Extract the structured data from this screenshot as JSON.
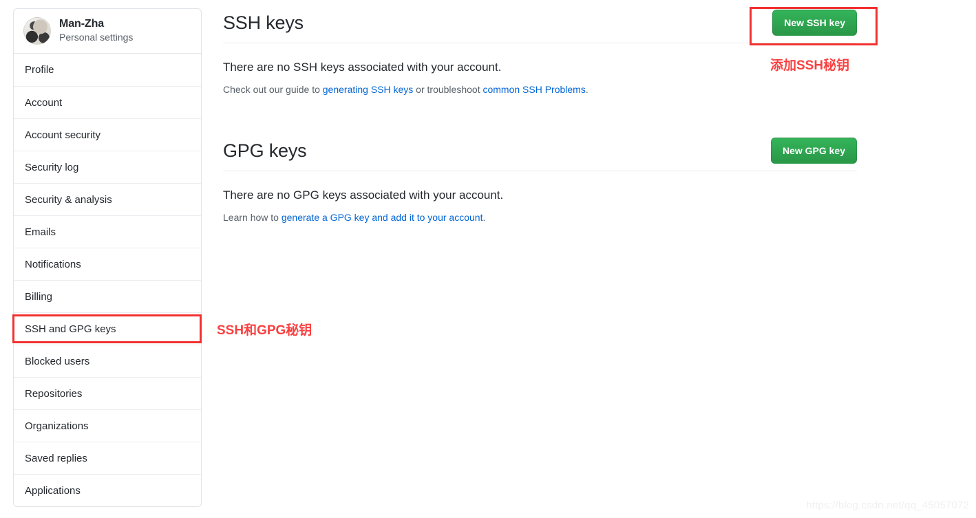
{
  "sidebar": {
    "user": {
      "name": "Man-Zha",
      "subtitle": "Personal settings",
      "avatar_icon": "user-avatar-photo"
    },
    "items": [
      {
        "label": "Profile",
        "selected": false
      },
      {
        "label": "Account",
        "selected": false
      },
      {
        "label": "Account security",
        "selected": false
      },
      {
        "label": "Security log",
        "selected": false
      },
      {
        "label": "Security & analysis",
        "selected": false
      },
      {
        "label": "Emails",
        "selected": false
      },
      {
        "label": "Notifications",
        "selected": false
      },
      {
        "label": "Billing",
        "selected": false
      },
      {
        "label": "SSH and GPG keys",
        "selected": true
      },
      {
        "label": "Blocked users",
        "selected": false
      },
      {
        "label": "Repositories",
        "selected": false
      },
      {
        "label": "Organizations",
        "selected": false
      },
      {
        "label": "Saved replies",
        "selected": false
      },
      {
        "label": "Applications",
        "selected": false
      }
    ]
  },
  "ssh_section": {
    "title": "SSH keys",
    "button_label": "New SSH key",
    "empty_message": "There are no SSH keys associated with your account.",
    "help_prefix": "Check out our guide to ",
    "help_link_1": "generating SSH keys",
    "help_middle": " or troubleshoot ",
    "help_link_2": "common SSH Problems",
    "help_suffix": "."
  },
  "gpg_section": {
    "title": "GPG keys",
    "button_label": "New GPG key",
    "empty_message": "There are no GPG keys associated with your account.",
    "help_prefix": "Learn how to ",
    "help_link_1": "generate a GPG key and add it to your account",
    "help_suffix": "."
  },
  "annotations": {
    "ssh_button_note": "添加SSH秘钥",
    "sidebar_note": "SSH和GPG秘钥",
    "box_color": "#f23030",
    "text_color": "#f94141"
  },
  "watermark": {
    "text": "https://blog.csdn.net/qq_45057072"
  },
  "colors": {
    "green_button": "#2ea44f",
    "link_blue": "#0366d6",
    "text_primary": "#24292e",
    "text_muted": "#586069",
    "border": "#e1e4e8"
  }
}
